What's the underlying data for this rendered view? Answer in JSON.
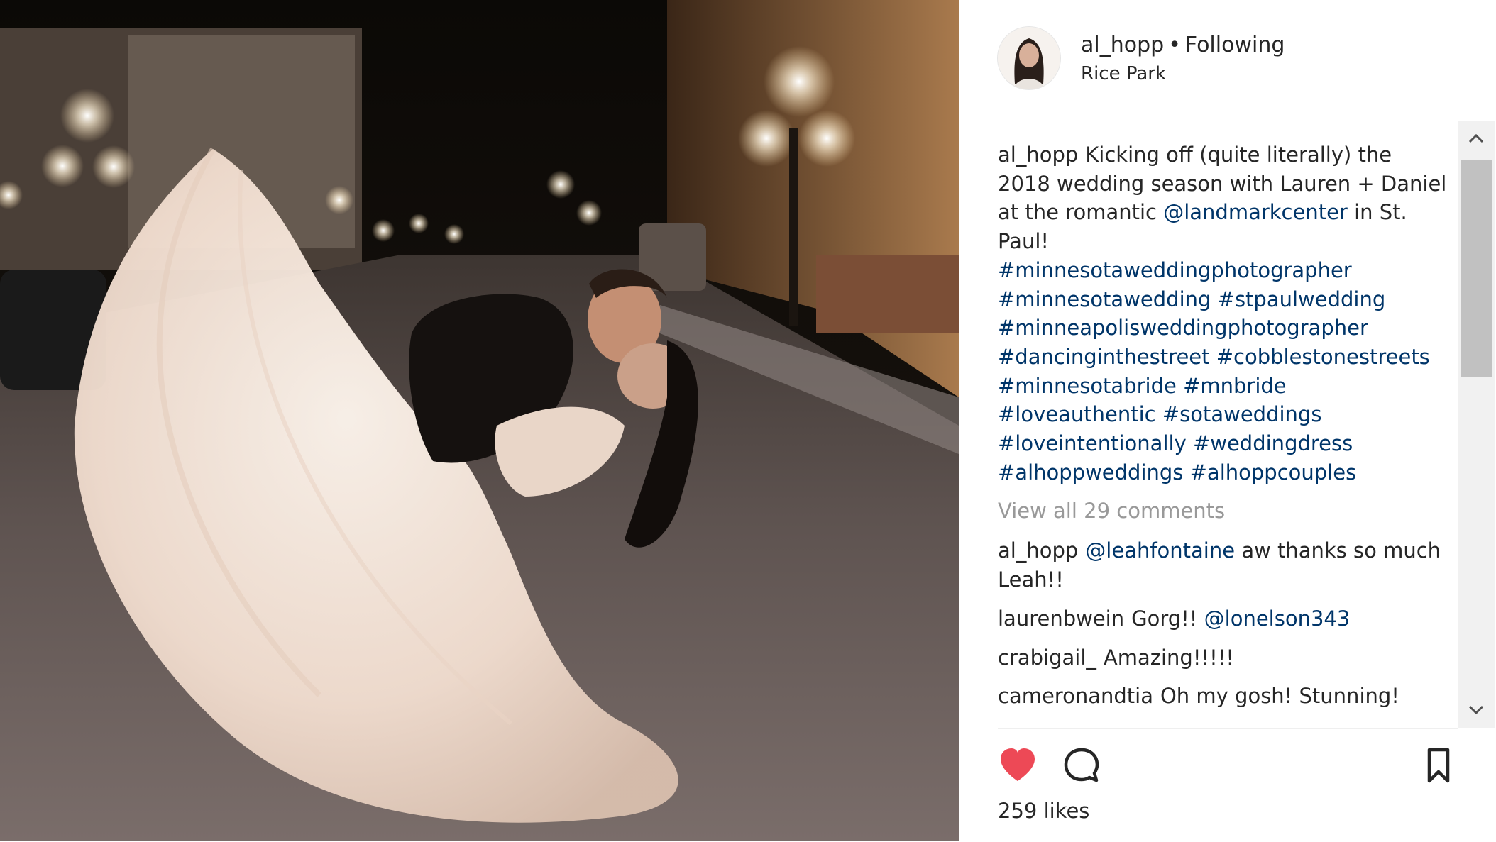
{
  "post": {
    "username": "al_hopp",
    "separator": "•",
    "follow_status": "Following",
    "location": "Rice Park",
    "caption": {
      "username": "al_hopp",
      "text_part1": "Kicking off (quite literally) the 2018 wedding season with Lauren + Daniel at the romantic",
      "mention": "@landmarkcenter",
      "text_part2": "in St. Paul!",
      "hashtags": [
        "#minnesotaweddingphotographer",
        "#minnesotawedding",
        "#stpaulwedding",
        "#minneapolisweddingphotographer",
        "#dancinginthestreet",
        "#cobblestonestreets",
        "#minnesotabride",
        "#mnbride",
        "#loveauthentic",
        "#sotaweddings",
        "#loveintentionally",
        "#weddingdress",
        "#alhoppweddings",
        "#alhoppcouples"
      ]
    },
    "view_all_comments": "View all 29 comments",
    "comments": [
      {
        "username": "al_hopp",
        "mention": "@leahfontaine",
        "text": "aw thanks so much Leah!!"
      },
      {
        "username": "laurenbwein",
        "text": "Gorg!!",
        "mention": "@lonelson343"
      },
      {
        "username": "crabigail_",
        "text": "Amazing!!!!!"
      },
      {
        "username": "cameronandtia",
        "text": "Oh my gosh! Stunning!"
      }
    ],
    "likes_text": "259 likes",
    "liked": true
  },
  "icons": {
    "like": "heart-icon",
    "comment": "comment-icon",
    "save": "bookmark-icon",
    "scroll_up": "chevron-up-icon",
    "scroll_down": "chevron-down-icon"
  },
  "colors": {
    "link": "#003569",
    "heart": "#ed4956",
    "muted": "#999999"
  }
}
